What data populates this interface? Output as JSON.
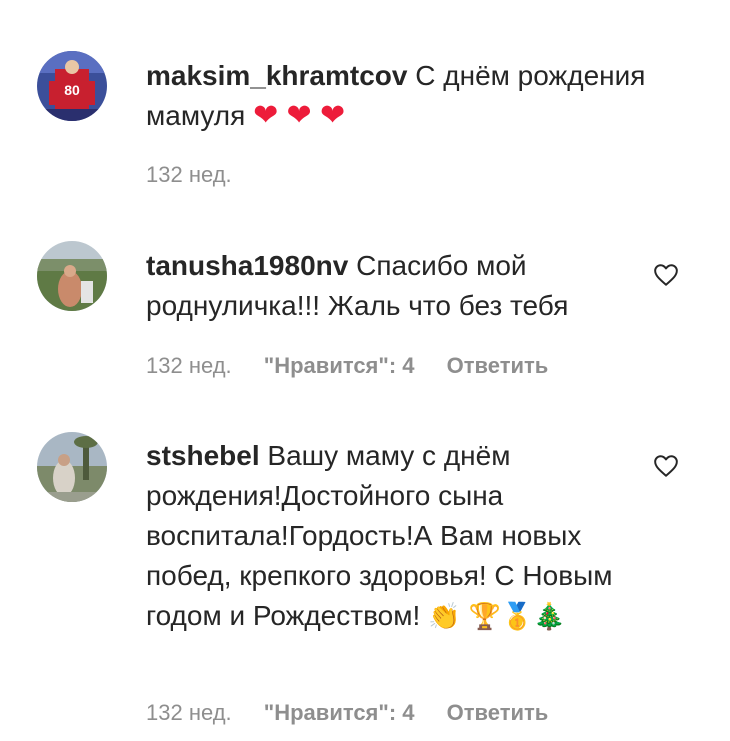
{
  "comments": [
    {
      "username": "maksim_khramtcov",
      "text": "С днём рождения мамуля",
      "emojis": "❤ ❤ ❤",
      "time": "132 нед."
    },
    {
      "username": "tanusha1980nv",
      "text": "Спасибо мой роднуличка!!! Жаль что без тебя",
      "time": "132 нед.",
      "likes_label": "\"Нравится\": 4",
      "reply_label": "Ответить"
    },
    {
      "username": "stshebel",
      "text": "Вашу маму с днём рождения!Достойного сына воспитала!Гордость!А Вам новых побед, крепкого здоровья! С Новым годом и Рождеством!",
      "emojis": "👏 🏆🥇🎄",
      "time": "132 нед.",
      "likes_label": "\"Нравится\": 4",
      "reply_label": "Ответить"
    }
  ],
  "icons": {
    "like": "heart-outline-icon"
  },
  "colors": {
    "text": "#262626",
    "meta": "#8e8e8e",
    "heart": "#ed1c3a"
  }
}
